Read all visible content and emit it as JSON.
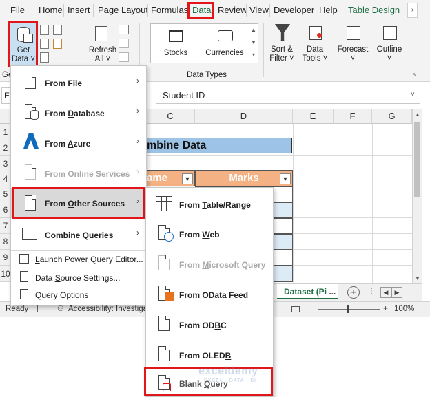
{
  "ribbon_tabs": [
    "File",
    "Home",
    "Insert",
    "Page Layout",
    "Formulas",
    "Data",
    "Review",
    "View",
    "Developer",
    "Help",
    "Table Design"
  ],
  "ribbon": {
    "get_data": [
      "Get",
      "Data"
    ],
    "refresh_all": [
      "Refresh",
      "All"
    ],
    "stocks": "Stocks",
    "currencies": "Currencies",
    "data_types_group": "Data Types",
    "sort_filter": [
      "Sort &",
      "Filter"
    ],
    "data_tools": [
      "Data",
      "Tools"
    ],
    "forecast": "Forecast",
    "outline": "Outline",
    "group_cut": "Ge"
  },
  "formula_bar": {
    "name_box": "E",
    "content": "Student ID"
  },
  "columns": [
    "C",
    "D",
    "E",
    "F",
    "G"
  ],
  "rows": [
    "1",
    "2",
    "3",
    "4",
    "5",
    "6",
    "7",
    "8",
    "9",
    "10"
  ],
  "sheet": {
    "title_fragment": "mbine Data",
    "header_name_fragment": "ame",
    "header_marks": "Marks"
  },
  "get_data_menu": {
    "items": [
      {
        "pre": "From ",
        "key": "F",
        "post": "ile",
        "disabled": false
      },
      {
        "pre": "From ",
        "key": "D",
        "post": "atabase",
        "disabled": false
      },
      {
        "pre": "From ",
        "key": "A",
        "post": "zure",
        "disabled": false
      },
      {
        "pre": "From Online Ser",
        "key": "v",
        "post": "ices",
        "disabled": true
      },
      {
        "pre": "From ",
        "key": "O",
        "post": "ther Sources",
        "disabled": false
      },
      {
        "pre": "Combine ",
        "key": "Q",
        "post": "ueries",
        "disabled": false
      }
    ],
    "plain_items": [
      {
        "pre": "",
        "key": "L",
        "post": "aunch Power Query Editor..."
      },
      {
        "pre": "Data ",
        "key": "S",
        "post": "ource Settings..."
      },
      {
        "pre": "Query O",
        "key": "p",
        "post": "tions"
      }
    ]
  },
  "other_sources_menu": {
    "items": [
      {
        "pre": "From ",
        "key": "T",
        "post": "able/Range",
        "disabled": false
      },
      {
        "pre": "From ",
        "key": "W",
        "post": "eb",
        "disabled": false
      },
      {
        "pre": "From ",
        "key": "M",
        "post": "icrosoft Query",
        "disabled": true
      },
      {
        "pre": "From ",
        "key": "O",
        "post": "Data Feed",
        "disabled": false
      },
      {
        "pre": "From OD",
        "key": "B",
        "post": "C",
        "disabled": false
      },
      {
        "pre": "From OLED",
        "key": "B",
        "post": "",
        "disabled": false
      },
      {
        "pre": "Blank ",
        "key": "Q",
        "post": "uery",
        "disabled": false
      }
    ]
  },
  "status_bar": {
    "ready": "Ready",
    "accessibility": "Accessibility: Investigate",
    "sheet_tab": "Dataset (Pi",
    "sheet_more": "...",
    "zoom": "100%"
  },
  "watermark": {
    "brand": "exceldemy",
    "tagline": "EXCEL · DATA · BI"
  },
  "colors": {
    "highlight": "#e0161b",
    "excel_green": "#1e6e42",
    "header_orange": "#f4b183",
    "title_blue": "#9dc3e6",
    "row_blue": "#ddebf7"
  }
}
